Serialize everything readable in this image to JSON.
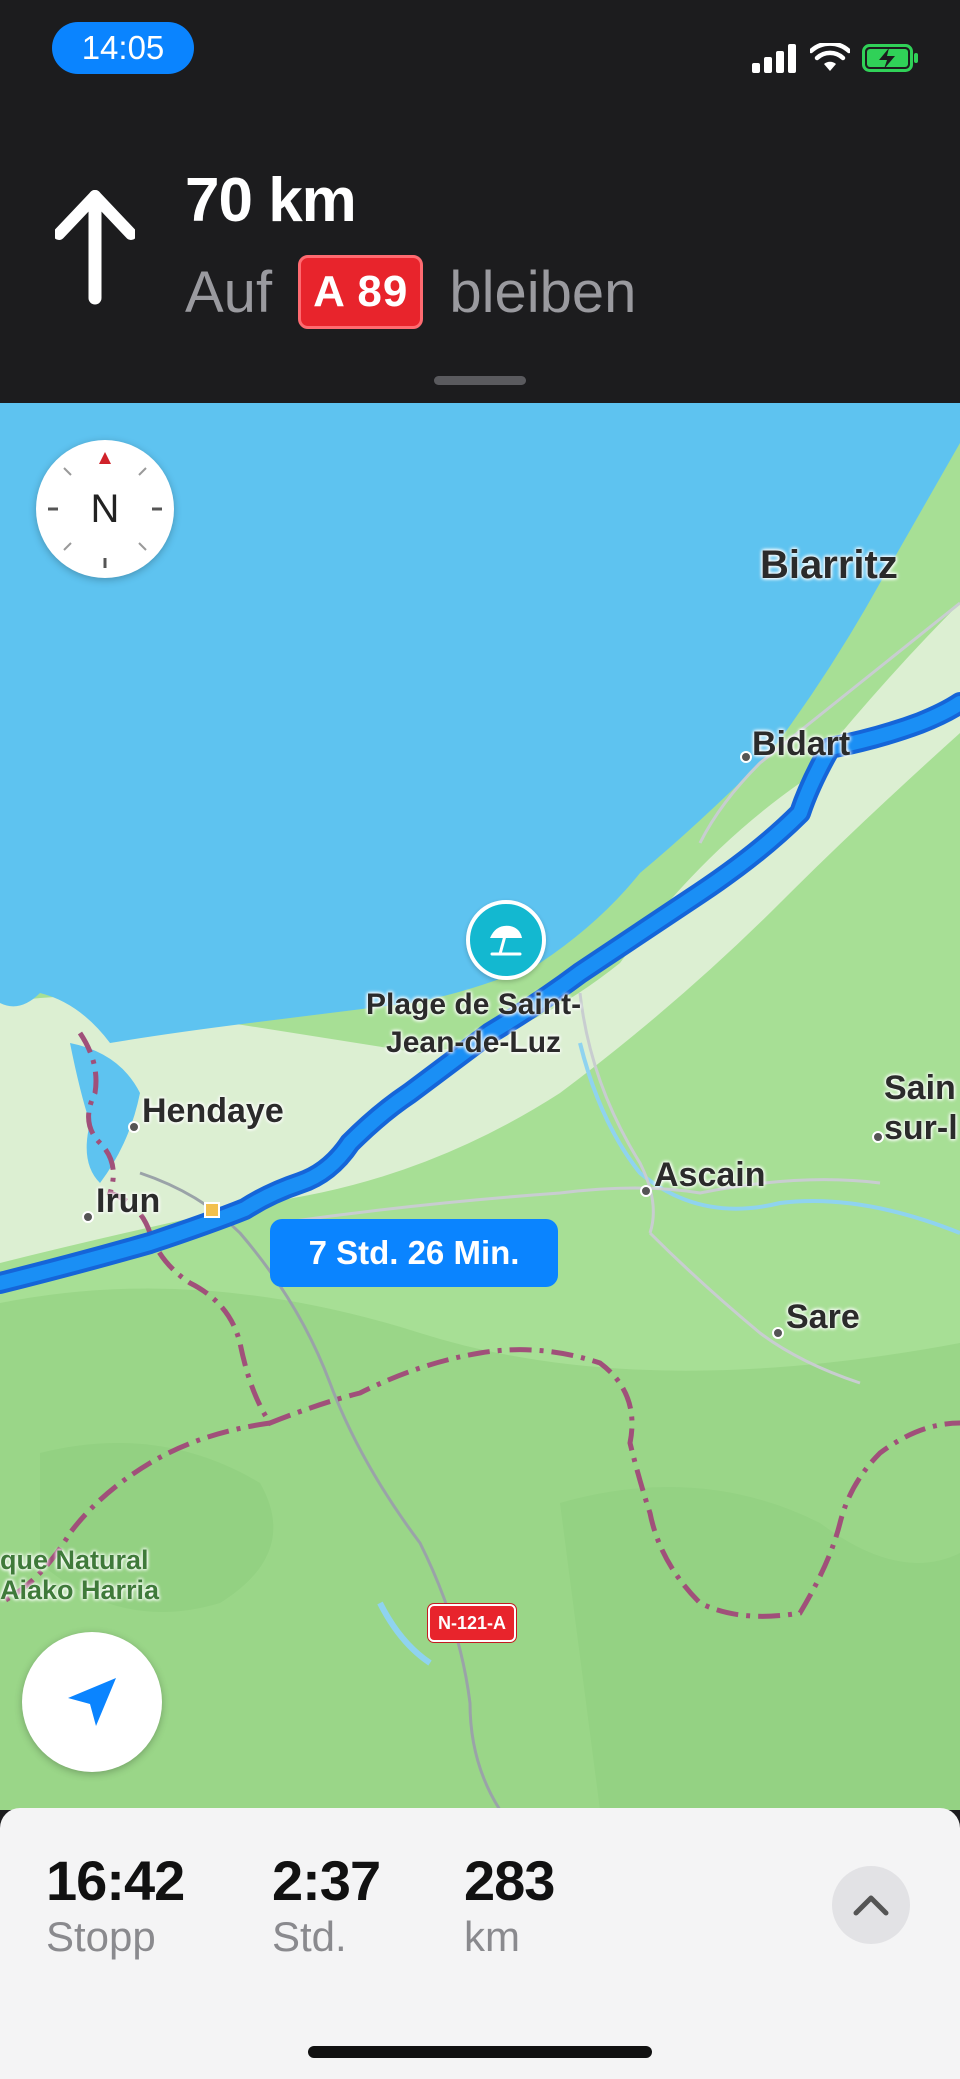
{
  "status_bar": {
    "time": "14:05",
    "signal_icon": "cellular-signal-icon",
    "wifi_icon": "wifi-icon",
    "battery_icon": "battery-charging-icon"
  },
  "navigation": {
    "maneuver_icon": "arrow-straight-up-icon",
    "distance": "70 km",
    "instruction_prefix": "Auf",
    "road_shield": "A 89",
    "instruction_suffix": "bleiben"
  },
  "map": {
    "compass_label": "N",
    "labels": {
      "biarritz": "Biarritz",
      "bidart": "Bidart",
      "poi_line1": "Plage de Saint-",
      "poi_line2": "Jean-de-Luz",
      "hendaye": "Hendaye",
      "irun": "Irun",
      "ascain": "Ascain",
      "sare": "Sare",
      "saint_line1": "Sain",
      "saint_line2": "sur-l",
      "park_line1": "que Natural",
      "park_line2": "Aiako Harria"
    },
    "route_duration": "7 Std. 26 Min.",
    "road_badge": "N-121-A",
    "poi_icon": "beach-umbrella-icon",
    "colors": {
      "water": "#5ec3f0",
      "land": "#a7df95",
      "route": "#1a7fe8",
      "border": "#a0507a"
    }
  },
  "trip": {
    "arrival_value": "16:42",
    "arrival_label": "Stopp",
    "duration_value": "2:37",
    "duration_label": "Std.",
    "distance_value": "283",
    "distance_label": "km",
    "expand_icon": "chevron-up-icon"
  }
}
